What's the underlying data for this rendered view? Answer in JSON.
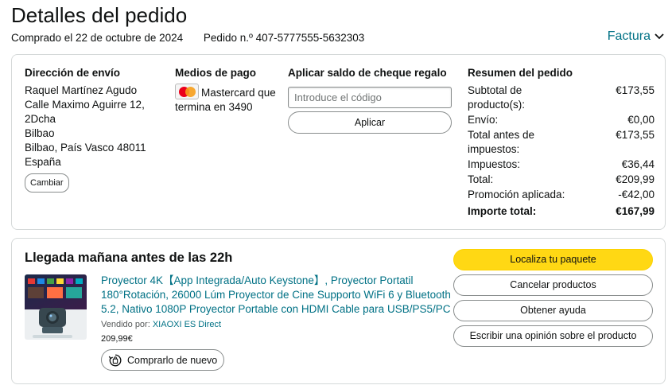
{
  "header": {
    "title": "Detalles del pedido",
    "ordered_on": "Comprado el 22 de octubre de 2024",
    "order_number": "Pedido n.º 407-5777555-5632303",
    "invoice_label": "Factura"
  },
  "details": {
    "shipping": {
      "title": "Dirección de envío",
      "lines": [
        "Raquel Martínez Agudo",
        "Calle Maximo Aguirre 12,",
        "2Dcha",
        "Bilbao",
        "Bilbao, País Vasco 48011",
        "España"
      ],
      "change_label": "Cambiar"
    },
    "payment": {
      "title": "Medios de pago",
      "card_text": "Mastercard que termina en 3490",
      "card_icon": "mastercard-logo"
    },
    "gift": {
      "title": "Aplicar saldo de cheque regalo",
      "placeholder": "Introduce el código",
      "apply_label": "Aplicar"
    },
    "summary": {
      "title": "Resumen del pedido",
      "rows": [
        {
          "label": "Subtotal de producto(s):",
          "value": "€173,55"
        },
        {
          "label": "Envío:",
          "value": "€0,00"
        },
        {
          "label": "Total antes de impuestos:",
          "value": "€173,55"
        },
        {
          "label": "Impuestos:",
          "value": "€36,44"
        },
        {
          "label": "Total:",
          "value": "€209,99"
        },
        {
          "label": "Promoción aplicada:",
          "value": "-€42,00"
        }
      ],
      "grand_total": {
        "label": "Importe total:",
        "value": "€167,99"
      }
    }
  },
  "shipment": {
    "arrival": "Llegada mañana antes de las 22h",
    "product": {
      "title": "Proyector 4K【App Integrada/Auto Keystone】, Proyector Portatil 180°Rotación, 26000 Lúm Proyector de Cine Supporto WiFi 6 y Bluetooth 5.2, Nativo 1080P Proyector Portable con HDMI Cable para USB/PS5/PC",
      "sold_by_label": "Vendido por:",
      "seller": "XIAOXI ES Direct",
      "price": "209,99€",
      "buy_again_label": "Comprarlo de nuevo"
    },
    "actions": {
      "track": "Localiza tu paquete",
      "cancel": "Cancelar productos",
      "help": "Obtener ayuda",
      "review": "Escribir una opinión sobre el producto"
    }
  },
  "colors": {
    "link": "#007185",
    "primary_button": "#ffd814",
    "border": "#d5d9d9"
  }
}
